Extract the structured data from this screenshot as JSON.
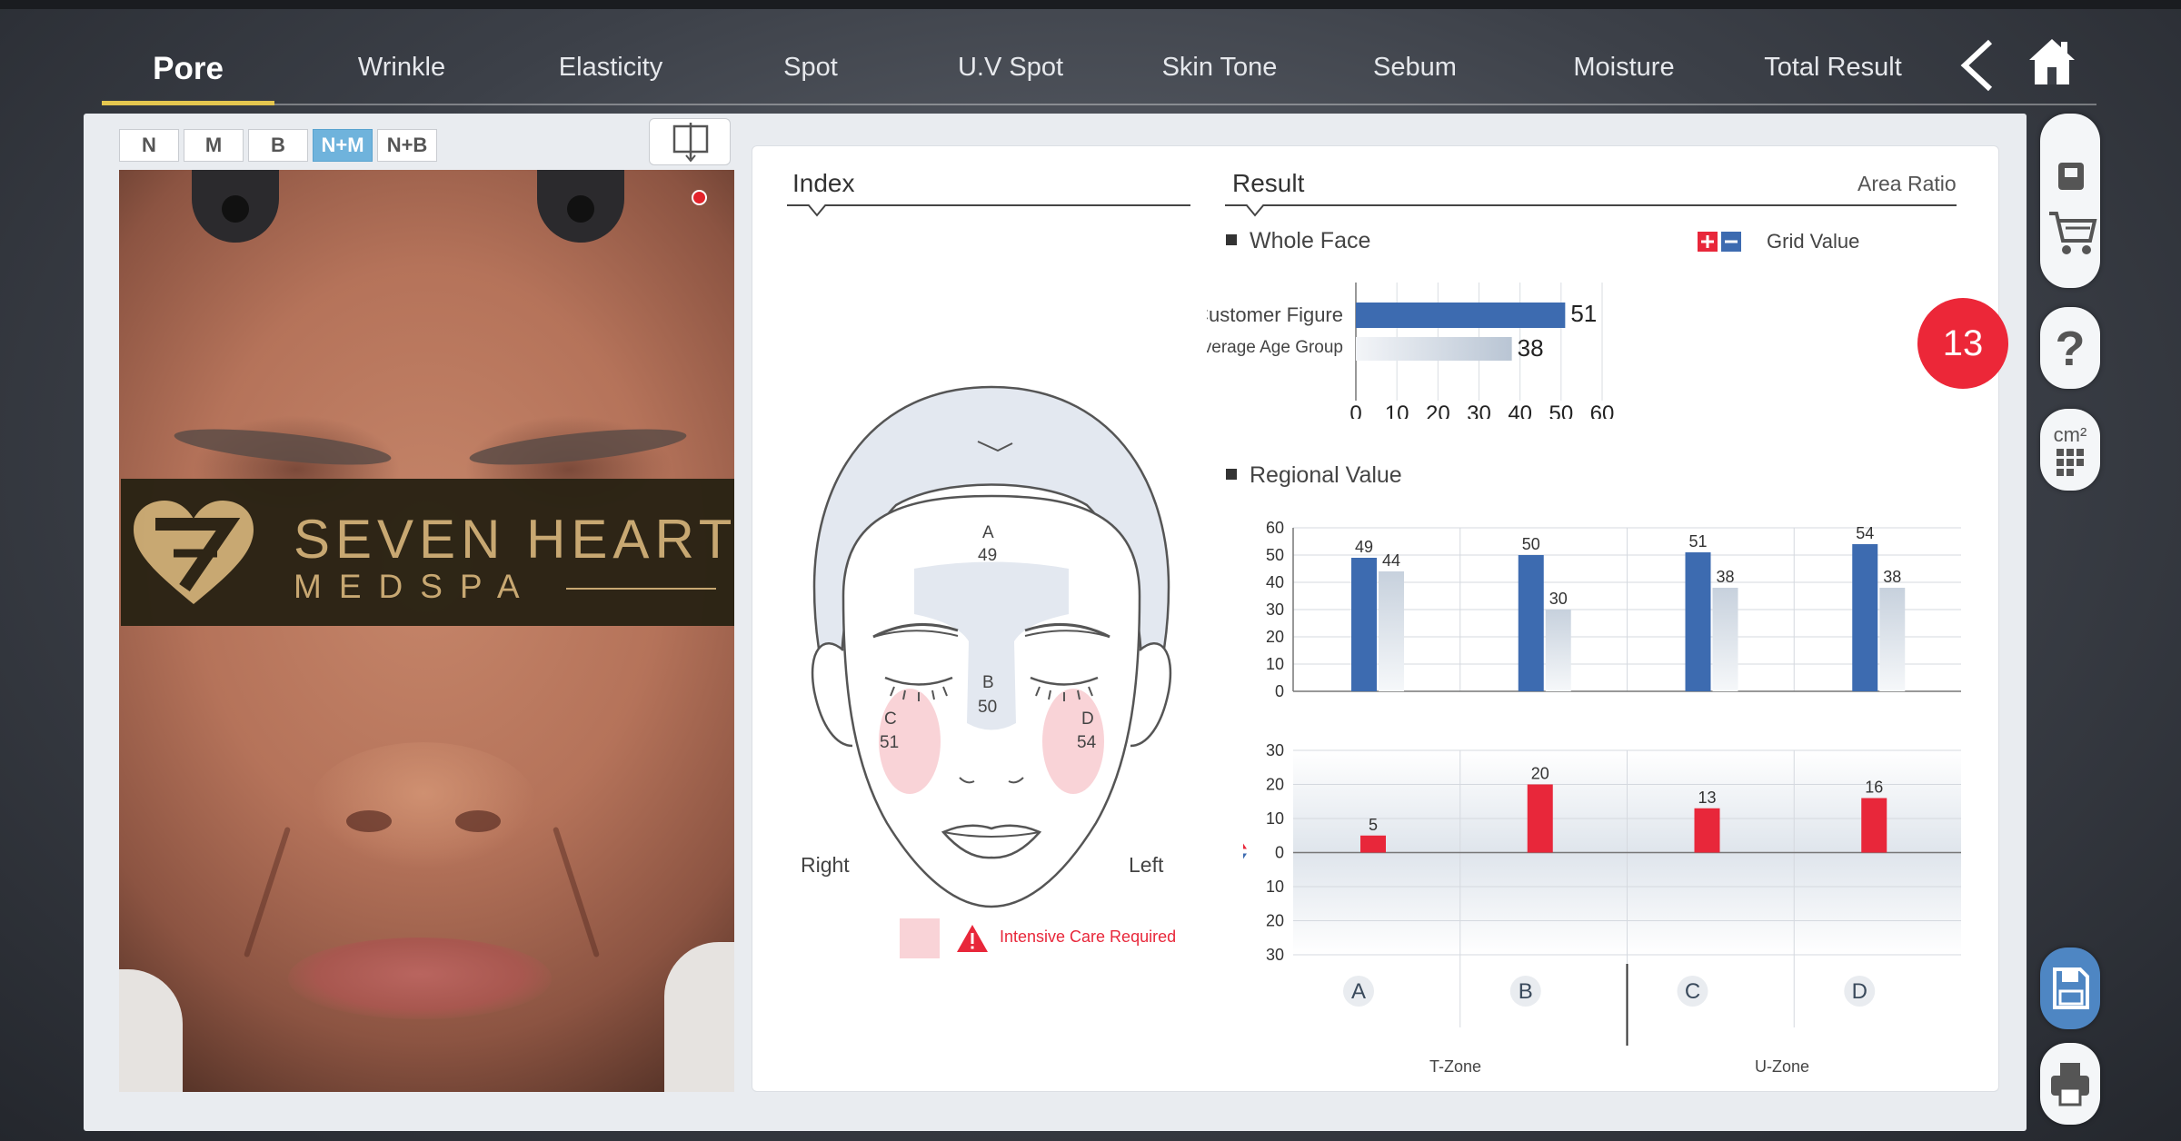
{
  "nav": {
    "tabs": [
      "Pore",
      "Wrinkle",
      "Elasticity",
      "Spot",
      "U.V Spot",
      "Skin Tone",
      "Sebum",
      "Moisture",
      "Total Result"
    ],
    "active_tab": "Pore"
  },
  "modes": [
    "N",
    "M",
    "B",
    "N+M",
    "N+B"
  ],
  "active_mode": "N+M",
  "logo": {
    "title": "SEVEN HEART",
    "subtitle": "MEDSPA"
  },
  "index": {
    "title": "Index",
    "face_labels": [
      {
        "letter": "A",
        "value": "49"
      },
      {
        "letter": "B",
        "value": "50"
      },
      {
        "letter": "C",
        "value": "51"
      },
      {
        "letter": "D",
        "value": "54"
      }
    ],
    "right_label": "Right",
    "left_label": "Left",
    "legend_text": "Intensive Care Required"
  },
  "result": {
    "title": "Result",
    "area_ratio": "Area Ratio",
    "whole_face": "Whole Face",
    "grid_value": "Grid Value",
    "regional_value": "Regional Value",
    "score": "13",
    "zone_t": "T-Zone",
    "zone_u": "U-Zone"
  },
  "colors": {
    "accent": "#3d6bb0",
    "alert": "#e8273a",
    "tab_underline": "#e4c64f"
  },
  "chart_data": [
    {
      "type": "bar",
      "orientation": "horizontal",
      "categories": [
        "Customer Figure",
        "Average Age Group"
      ],
      "values": [
        51,
        38
      ],
      "xlim": [
        0,
        60
      ],
      "xticks": [
        0,
        10,
        20,
        30,
        40,
        50,
        60
      ]
    },
    {
      "type": "bar",
      "categories": [
        "A",
        "B",
        "C",
        "D"
      ],
      "series": [
        {
          "values": [
            49,
            50,
            51,
            54
          ]
        },
        {
          "values": [
            44,
            30,
            38,
            38
          ]
        }
      ],
      "ylim": [
        0,
        60
      ],
      "yticks": [
        0,
        10,
        20,
        30,
        40,
        50,
        60
      ]
    },
    {
      "type": "bar",
      "categories": [
        "A",
        "B",
        "C",
        "D"
      ],
      "values": [
        5,
        20,
        13,
        16
      ],
      "ylim": [
        -30,
        30
      ],
      "yticks": [
        30,
        20,
        10,
        0,
        10,
        20,
        30
      ]
    }
  ]
}
